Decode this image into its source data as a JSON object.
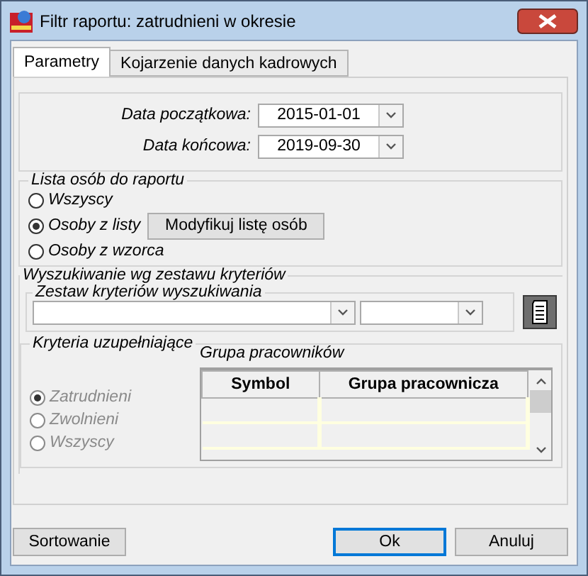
{
  "window": {
    "title": "Filtr raportu: zatrudnieni w okresie"
  },
  "tabs": [
    {
      "label": "Parametry",
      "selected": true
    },
    {
      "label": "Kojarzenie danych kadrowych",
      "selected": false
    }
  ],
  "dates": [
    {
      "label": "Data początkowa:",
      "value": "2015-01-01"
    },
    {
      "label": "Data końcowa:",
      "value": "2019-09-30"
    }
  ],
  "person_list": {
    "title": "Lista osób do raportu",
    "options": [
      {
        "label": "Wszyscy",
        "selected": false
      },
      {
        "label": "Osoby z listy",
        "selected": true
      },
      {
        "label": "Osoby z wzorca",
        "selected": false
      }
    ],
    "button": "Modyfikuj listę osób"
  },
  "search": {
    "title": "Wyszukiwanie wg zestawu kryteriów",
    "criteria_set": {
      "title": "Zestaw kryteriów wyszukiwania"
    }
  },
  "supplementary": {
    "title": "Kryteria uzupełniające",
    "options": [
      {
        "label": "Zatrudnieni",
        "selected": true,
        "disabled": true
      },
      {
        "label": "Zwolnieni",
        "selected": false,
        "disabled": true
      },
      {
        "label": "Wszyscy",
        "selected": false,
        "disabled": true
      }
    ],
    "group_table": {
      "title": "Grupa pracowników",
      "columns": [
        "Symbol",
        "Grupa pracownicza"
      ]
    }
  },
  "buttons": [
    {
      "label": "Sortowanie",
      "default": false
    },
    {
      "label": "Ok",
      "default": true
    },
    {
      "label": "Anuluj",
      "default": false
    }
  ]
}
